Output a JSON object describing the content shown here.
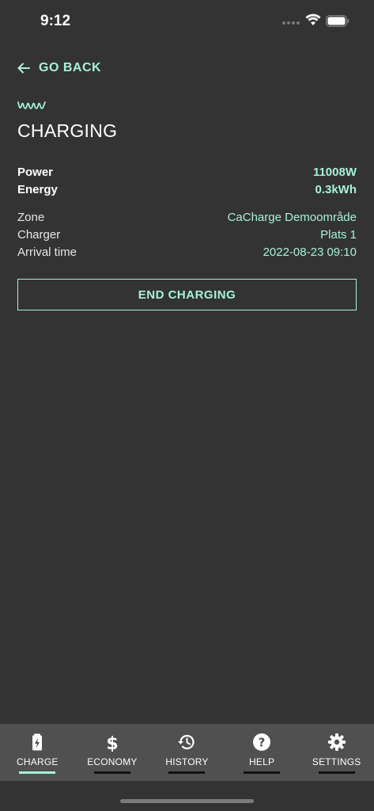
{
  "status_bar": {
    "time": "9:12"
  },
  "nav": {
    "back_label": "GO BACK"
  },
  "page": {
    "title": "CHARGING"
  },
  "stats": [
    {
      "label": "Power",
      "value": "11008W"
    },
    {
      "label": "Energy",
      "value": "0.3kWh"
    }
  ],
  "details": [
    {
      "label": "Zone",
      "value": "CaCharge Demoområde"
    },
    {
      "label": "Charger",
      "value": "Plats 1"
    },
    {
      "label": "Arrival time",
      "value": "2022-08-23 09:10"
    }
  ],
  "actions": {
    "end_label": "END CHARGING"
  },
  "tabs": [
    {
      "label": "CHARGE",
      "icon": "battery-charging-icon",
      "active": true
    },
    {
      "label": "ECONOMY",
      "icon": "dollar-icon",
      "active": false
    },
    {
      "label": "HISTORY",
      "icon": "history-icon",
      "active": false
    },
    {
      "label": "HELP",
      "icon": "help-icon",
      "active": false
    },
    {
      "label": "SETTINGS",
      "icon": "gear-icon",
      "active": false
    }
  ],
  "colors": {
    "background": "#333333",
    "accent": "#a7f1d9",
    "tab_bar": "#505050"
  }
}
